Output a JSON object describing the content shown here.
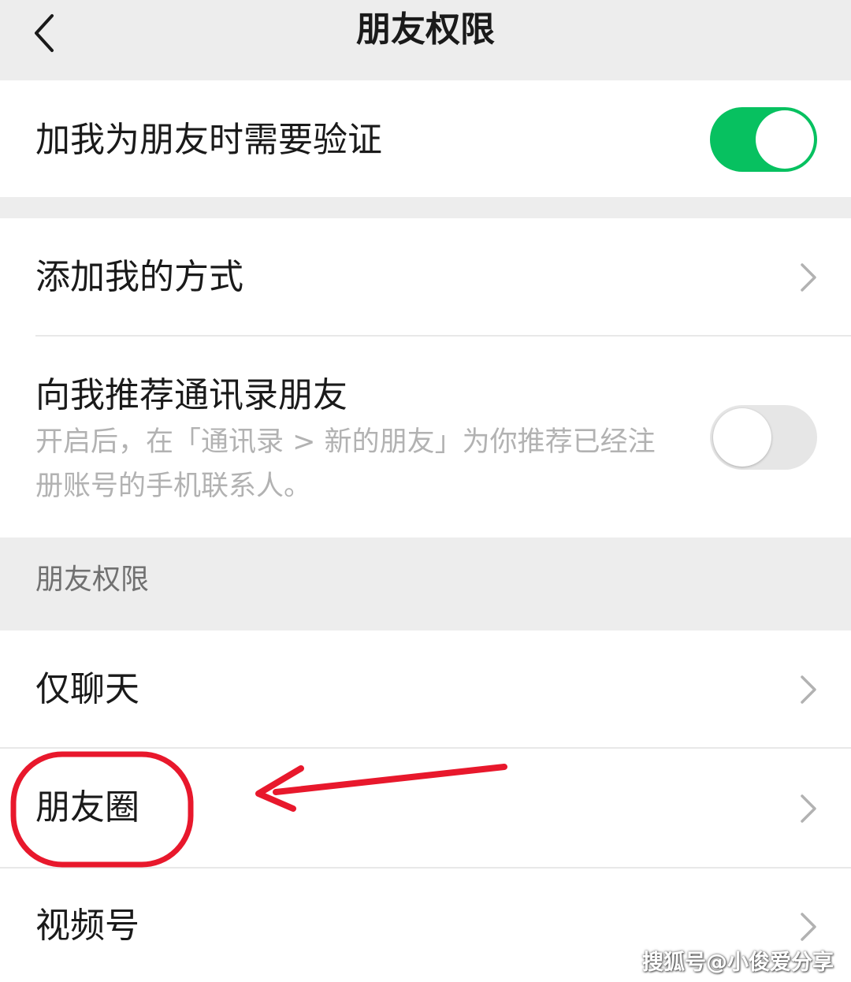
{
  "nav": {
    "title": "朋友权限",
    "back_icon": "chevron-left-icon"
  },
  "verify": {
    "label": "加我为朋友时需要验证",
    "enabled": true
  },
  "add_methods": {
    "label": "添加我的方式"
  },
  "recommend": {
    "label": "向我推荐通讯录朋友",
    "description_line1": "开启后，在「通讯录 > 新的朋友」为你推荐已经注",
    "description_line2": "册账号的手机联系人。",
    "enabled": false
  },
  "section": {
    "title": "朋友权限",
    "items": [
      {
        "label": "仅聊天"
      },
      {
        "label": "朋友圈"
      },
      {
        "label": "视频号"
      }
    ]
  },
  "annotation": {
    "color": "#e8182c",
    "highlighted_item": "朋友圈"
  },
  "watermark": "搜狐号@小俊爱分享",
  "colors": {
    "accent": "#07c160",
    "background": "#ededed"
  }
}
